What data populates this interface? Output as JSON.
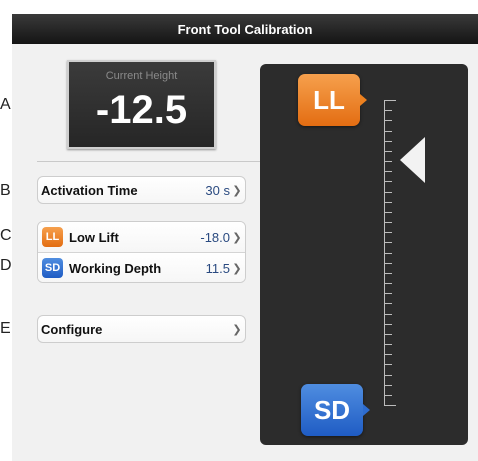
{
  "callouts": [
    "A",
    "B",
    "C",
    "D",
    "E"
  ],
  "title": "Front Tool Calibration",
  "height_display": {
    "label": "Current Height",
    "value": "-12.5"
  },
  "rows": {
    "activation": {
      "label": "Activation Time",
      "value": "30 s"
    },
    "low_lift": {
      "badge": "LL",
      "label": "Low Lift",
      "value": "-18.0"
    },
    "working_depth": {
      "badge": "SD",
      "label": "Working Depth",
      "value": "11.5"
    },
    "configure": {
      "label": "Configure"
    }
  },
  "gauge": {
    "top_badge": "LL",
    "bottom_badge": "SD",
    "tick_count": 30
  },
  "icons": {
    "chevron": "chevron-right-icon",
    "pointer": "triangle-left-icon"
  },
  "colors": {
    "orange": "#e97d1e",
    "blue": "#2e6ccf",
    "value_text": "#2a4a80"
  }
}
